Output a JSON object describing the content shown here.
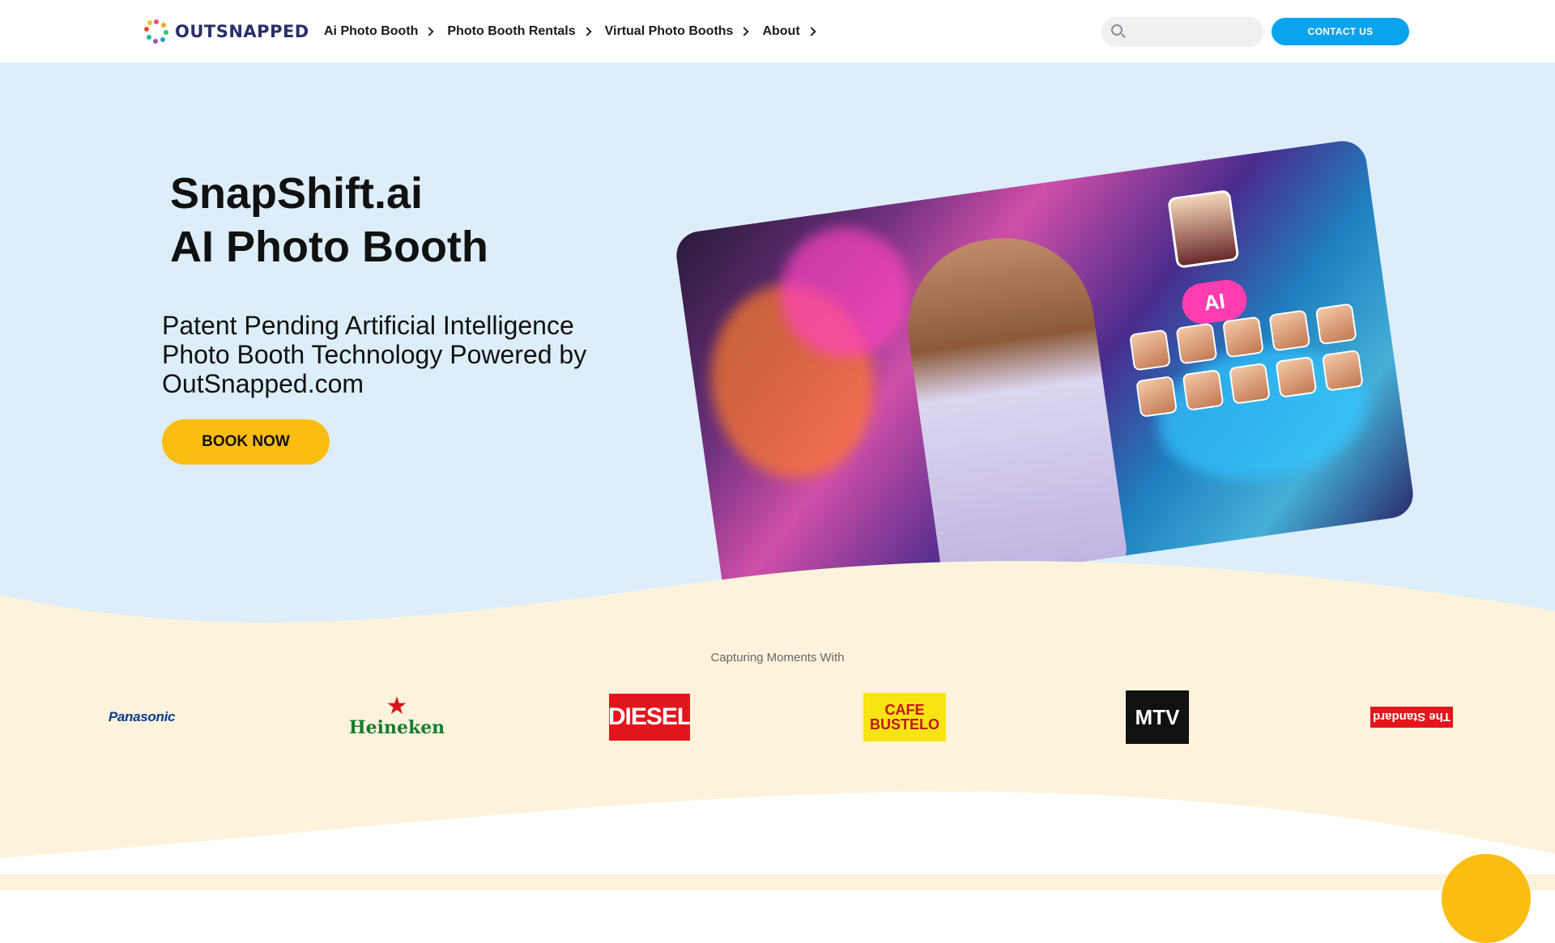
{
  "header": {
    "logo_text": "OUTSNAPPED",
    "nav": [
      "Ai Photo Booth",
      "Photo Booth Rentals",
      "Virtual Photo Booths",
      "About"
    ],
    "search_placeholder": "",
    "contact_label": "CONTACT US"
  },
  "hero": {
    "title_line1": "SnapShift.ai",
    "title_line2": "AI Photo Booth",
    "subtitle": "Patent Pending Artificial Intelligence Photo Booth Technology Powered by OutSnapped.com",
    "book_label": "BOOK NOW",
    "ai_badge": "AI"
  },
  "clients": {
    "caption": "Capturing Moments With",
    "brands": [
      "Panasonic",
      "Heineken",
      "DIESEL",
      "CAFE BUSTELO",
      "MTV",
      "The Standard"
    ]
  },
  "colors": {
    "accent_blue": "#0aa3ee",
    "accent_yellow": "#fbbd11",
    "hero_bg": "#ddeefa",
    "band_bg": "#fdf3dc"
  }
}
